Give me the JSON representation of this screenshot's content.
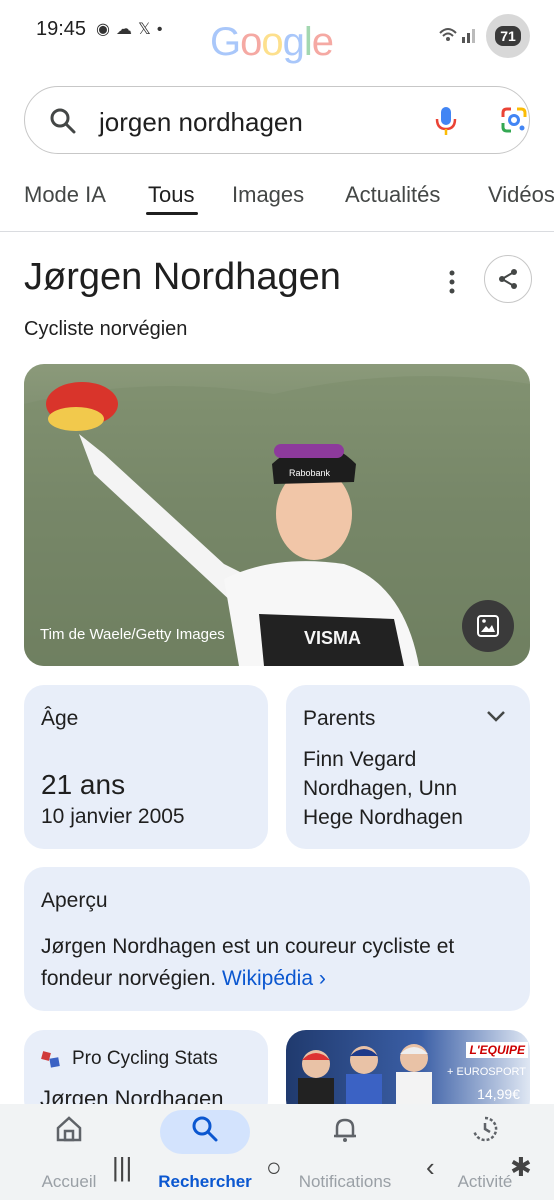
{
  "status_bar": {
    "time": "19:45",
    "icons": [
      "messenger-icon",
      "weather-icon",
      "x-icon",
      "dot-icon"
    ],
    "battery": "71"
  },
  "logo": {
    "text": "Google"
  },
  "search": {
    "query": "jorgen nordhagen"
  },
  "tabs": [
    {
      "label": "Mode IA",
      "active": false
    },
    {
      "label": "Tous",
      "active": true
    },
    {
      "label": "Images",
      "active": false
    },
    {
      "label": "Actualités",
      "active": false
    },
    {
      "label": "Vidéos",
      "active": false
    }
  ],
  "entity": {
    "title": "Jørgen Nordhagen",
    "subtitle": "Cycliste norvégien",
    "image_credit": "Tim de Waele/Getty Images"
  },
  "cards": {
    "age": {
      "label": "Âge",
      "value": "21 ans",
      "date": "10 janvier 2005"
    },
    "parents": {
      "label": "Parents",
      "value": "Finn Vegard Nordhagen, Unn Hege Nordhagen"
    },
    "overview": {
      "label": "Aperçu",
      "text": "Jørgen Nordhagen est un coureur cycliste et fondeur norvégien.",
      "link": "Wikipédia",
      "link_arrow": "›"
    },
    "pcs": {
      "source": "Pro Cycling Stats",
      "title": "Jørgen Nordhagen"
    },
    "news": {
      "badge": "L'EQUIPE",
      "sub": "+ EUROSPORT",
      "price": "14,99€"
    }
  },
  "bottom_nav": [
    {
      "label": "Accueil",
      "active": false
    },
    {
      "label": "Rechercher",
      "active": true
    },
    {
      "label": "Notifications",
      "active": false
    },
    {
      "label": "Activité",
      "active": false
    }
  ],
  "colors": {
    "accent": "#0b57d0",
    "card_bg": "#e8eef9",
    "active_pill": "#d3e3fd"
  }
}
